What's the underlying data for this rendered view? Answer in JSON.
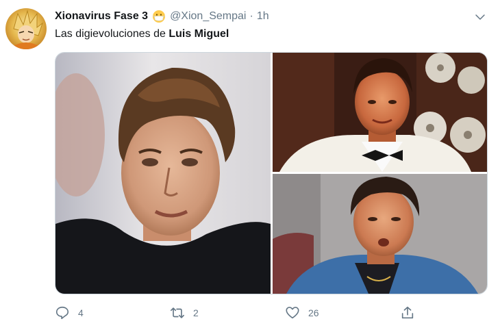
{
  "author": {
    "display_name": "Xionavirus Fase 3",
    "handle": "@Xion_Sempai",
    "separator": "·",
    "time": "1h"
  },
  "tweet": {
    "text_prefix": "Las digievoluciones de ",
    "text_bold": "Luis Miguel"
  },
  "actions": {
    "reply_count": "4",
    "retweet_count": "2",
    "like_count": "26"
  },
  "icons": {
    "avatar": "avatar-anime-character",
    "emoji": "face-with-medical-mask-emoji",
    "more": "chevron-down-icon",
    "reply": "reply-icon",
    "retweet": "retweet-icon",
    "like": "heart-icon",
    "share": "share-icon"
  },
  "colors": {
    "text": "#14171a",
    "secondary": "#657786",
    "border": "#ccd6dd"
  }
}
